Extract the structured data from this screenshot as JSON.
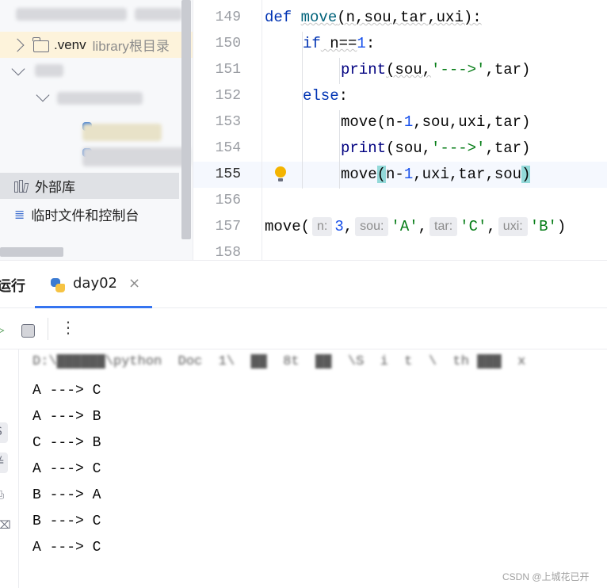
{
  "project_panel": {
    "venv_name": ".venv",
    "venv_hint": "library根目录",
    "external_libraries": "外部库",
    "scratches": "临时文件和控制台"
  },
  "editor": {
    "line_numbers": [
      "149",
      "150",
      "151",
      "152",
      "153",
      "154",
      "155",
      "156",
      "157",
      "158"
    ],
    "current_line": "155",
    "code": {
      "l149_kw": "def",
      "l149_fn": "move",
      "l149_rest": "(n,sou,tar,uxi):",
      "l150_kw": "if",
      "l150_a": " n==",
      "l150_num": "1",
      "l150_b": ":",
      "l151_bi": "print",
      "l151_a": "(sou,",
      "l151_str": "'--->'",
      "l151_b": ",tar)",
      "l152_kw": "else",
      "l152_b": ":",
      "l153_a": "move(n-",
      "l153_num": "1",
      "l153_b": ",sou,uxi,tar)",
      "l154_bi": "print",
      "l154_a": "(sou,",
      "l154_str": "'--->'",
      "l154_b": ",tar)",
      "l155_a": "move",
      "l155_paren_open": "(",
      "l155_b": "n-",
      "l155_num": "1",
      "l155_c": ",uxi,tar,sou",
      "l155_paren_close": ")",
      "l157_a": "move(",
      "l157_hint_n": "n:",
      "l157_num": "3",
      "l157_comma1": ",",
      "l157_hint_sou": "sou:",
      "l157_str_a": "'A'",
      "l157_comma2": ",",
      "l157_hint_tar": "tar:",
      "l157_str_c": "'C'",
      "l157_comma3": ",",
      "l157_hint_uxi": "uxi:",
      "l157_str_b": "'B'",
      "l157_close": ")"
    }
  },
  "run_panel": {
    "title": "运行",
    "tab_label": "day02",
    "tab_close": "×",
    "console_output": [
      "A ---> C",
      "A ---> B",
      "C ---> B",
      "A ---> C",
      "B ---> A",
      "B ---> C",
      "A ---> C"
    ]
  },
  "watermark": "CSDN @上城花已开"
}
